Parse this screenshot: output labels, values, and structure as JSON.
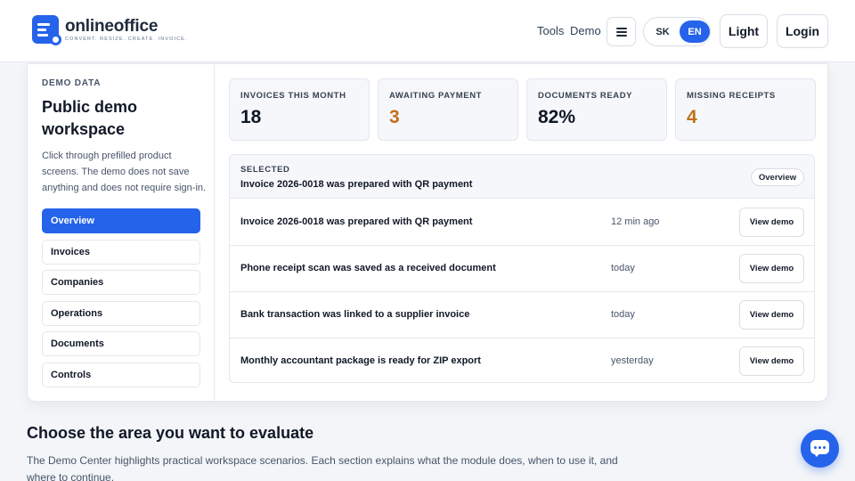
{
  "header": {
    "brand_name": "onlineoffice",
    "brand_tagline": "CONVERT. RESIZE. CREATE. INVOICE.",
    "nav": [
      "Tools",
      "Demo"
    ],
    "lang_options": [
      "SK",
      "EN"
    ],
    "lang_selected": "EN",
    "theme_label": "Light",
    "login_label": "Login",
    "icons": {
      "menu": "hamburger-icon",
      "logo": "document-logo-icon"
    }
  },
  "sidebar": {
    "eyebrow": "DEMO DATA",
    "title": "Public demo workspace",
    "description": "Click through prefilled product screens. The demo does not save anything and does not require sign-in.",
    "items": [
      {
        "label": "Overview",
        "active": true
      },
      {
        "label": "Invoices"
      },
      {
        "label": "Companies"
      },
      {
        "label": "Operations"
      },
      {
        "label": "Documents"
      },
      {
        "label": "Controls"
      }
    ]
  },
  "kpis": [
    {
      "label": "INVOICES THIS MONTH",
      "value": "18",
      "color": "#111827"
    },
    {
      "label": "AWAITING PAYMENT",
      "value": "3",
      "color": "#c2701d"
    },
    {
      "label": "DOCUMENTS READY",
      "value": "82%",
      "color": "#111827"
    },
    {
      "label": "MISSING RECEIPTS",
      "value": "4",
      "color": "#c2701d"
    }
  ],
  "selected": {
    "label": "SELECTED",
    "title": "Invoice 2026-0018 was prepared with QR payment",
    "badge": "Overview"
  },
  "activity": [
    {
      "title": "Invoice 2026-0018 was prepared with QR payment",
      "time": "12 min ago",
      "action": "View demo"
    },
    {
      "title": "Phone receipt scan was saved as a received document",
      "time": "today",
      "action": "View demo"
    },
    {
      "title": "Bank transaction was linked to a supplier invoice",
      "time": "today",
      "action": "View demo"
    },
    {
      "title": "Monthly accountant package is ready for ZIP export",
      "time": "yesterday",
      "action": "View demo"
    }
  ],
  "section": {
    "title": "Choose the area you want to evaluate",
    "description": "The Demo Center highlights practical workspace scenarios. Each section explains what the module does, when to use it, and where to continue."
  },
  "colors": {
    "accent": "#2563eb",
    "warning": "#c2701d"
  },
  "chat_icon": "chat-bubble-icon"
}
